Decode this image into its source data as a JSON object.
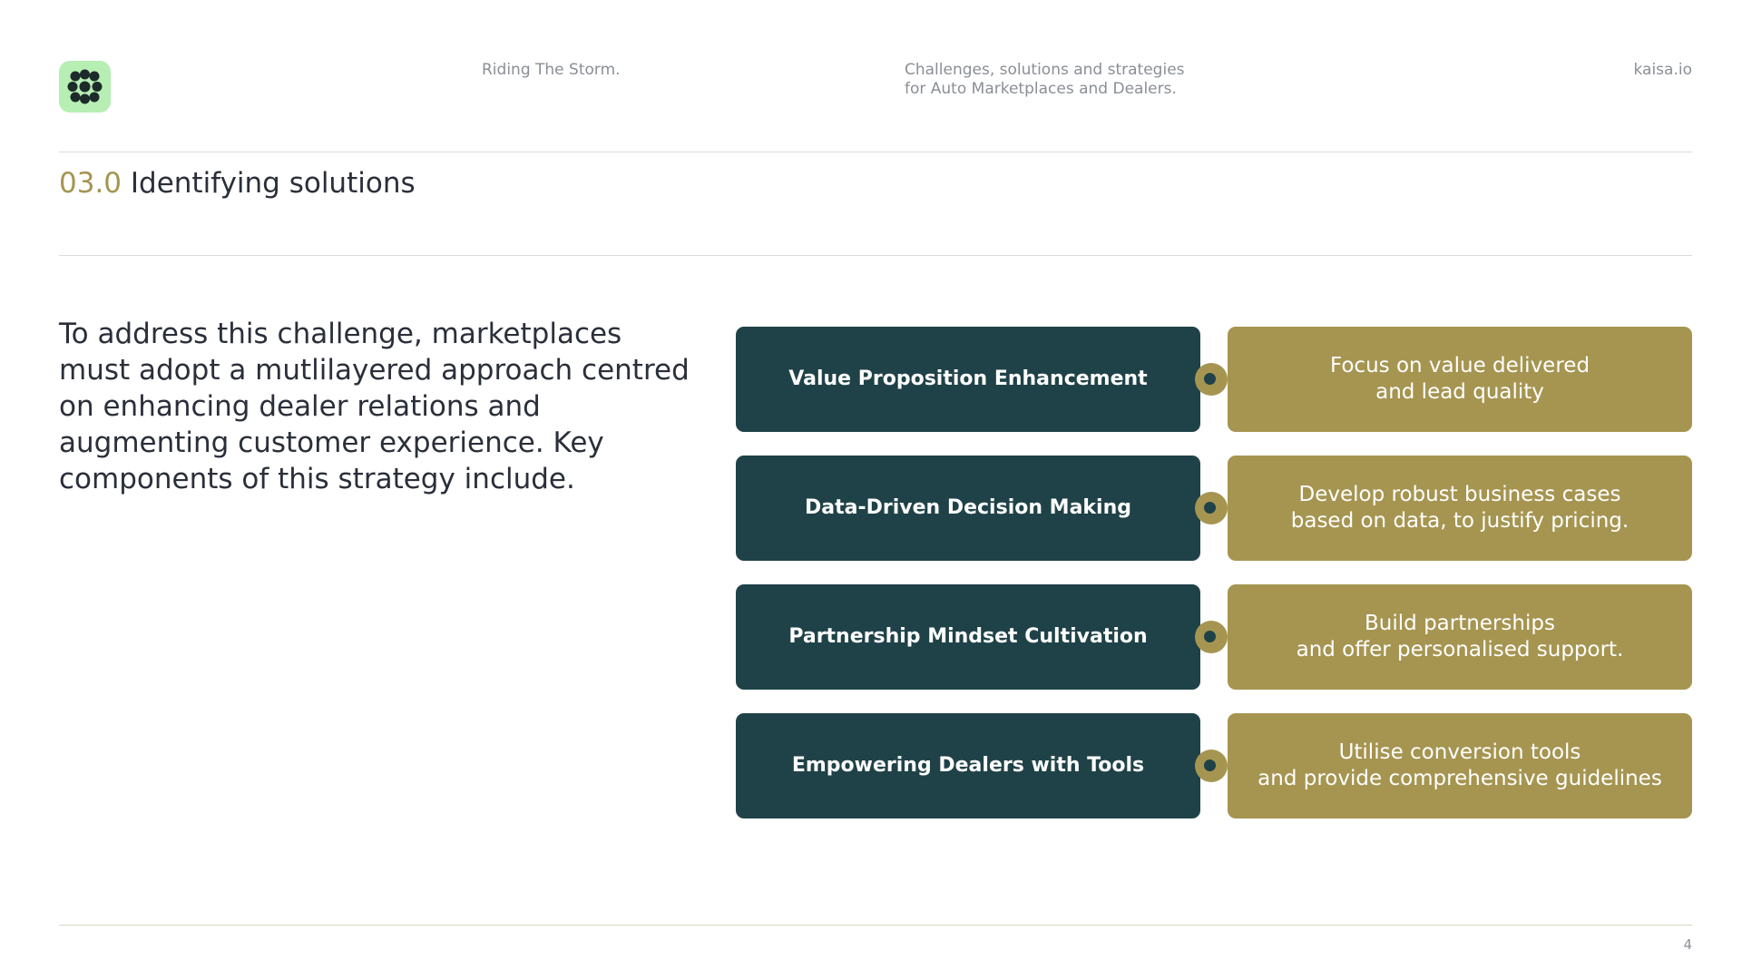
{
  "header": {
    "logo_icon": "kaisa-logo-icon",
    "doc_title": "Riding The Storm.",
    "doc_subtitle": "Challenges, solutions and strategies\nfor Auto Marketplaces and Dealers.",
    "brand": "kaisa.io"
  },
  "section": {
    "number": "03.0",
    "title": "Identifying solutions"
  },
  "intro": "To address this challenge, marketplaces must adopt a mutlilayered approach centred on enhancing dealer relations and augmenting customer experience. Key components of this strategy include.",
  "strategies": [
    {
      "label": "Value Proposition Enhancement",
      "detail": "Focus on value delivered\nand lead quality"
    },
    {
      "label": "Data-Driven Decision Making",
      "detail": "Develop robust business cases\nbased on data, to justify pricing."
    },
    {
      "label": "Partnership Mindset Cultivation",
      "detail": "Build partnerships\nand offer personalised support."
    },
    {
      "label": "Empowering Dealers with Tools",
      "detail": "Utilise conversion tools\nand provide comprehensive guidelines"
    }
  ],
  "footer": {
    "page_number": "4"
  },
  "colors": {
    "dark_teal": "#1f4248",
    "gold": "#a69551",
    "logo_green": "#b7eeb4",
    "text": "#2a2f3a",
    "muted": "#8a8f96"
  }
}
